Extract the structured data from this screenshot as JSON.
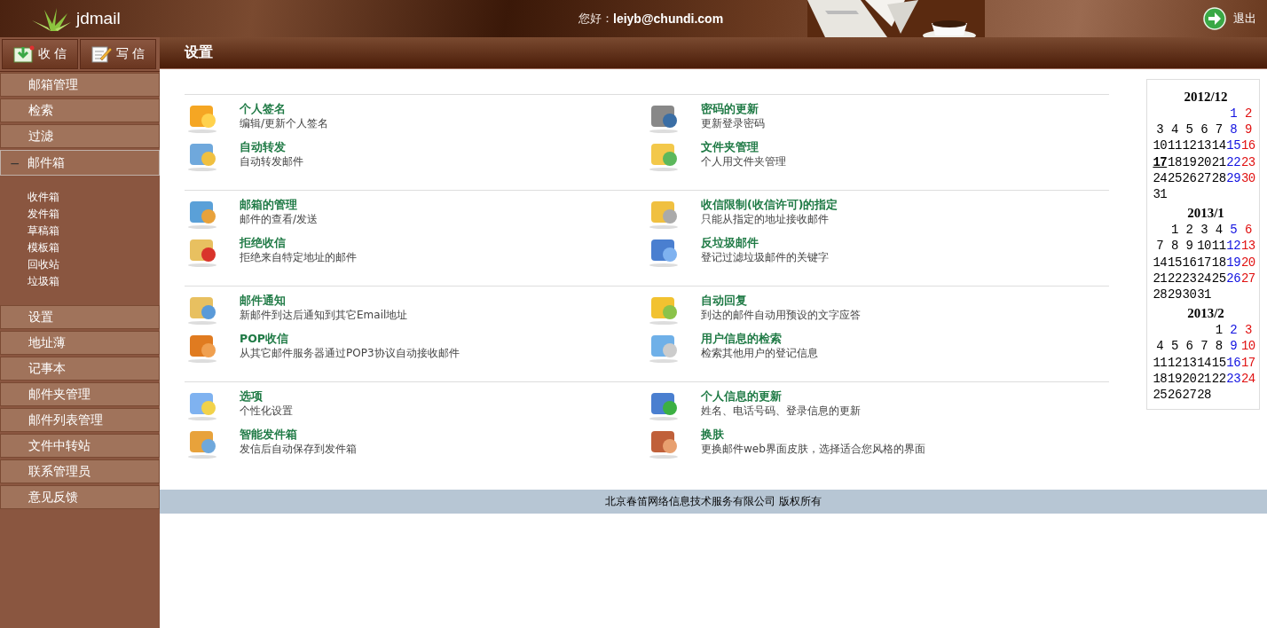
{
  "header": {
    "logo": "jdmail",
    "greeting": "您好：",
    "user": "leiyb@chundi.com",
    "logout": "退出"
  },
  "toolbar": [
    {
      "label": "收 信",
      "kind": "inbox"
    },
    {
      "label": "写 信",
      "kind": "compose"
    }
  ],
  "sidebar": {
    "items": [
      {
        "label": "邮箱管理",
        "kind": "link"
      },
      {
        "label": "检索",
        "kind": "link"
      },
      {
        "label": "过滤",
        "kind": "link"
      },
      {
        "label": "邮件箱",
        "kind": "folder",
        "toggle": "−",
        "expanded": true,
        "children": [
          "收件箱",
          "发件箱",
          "草稿箱",
          "模板箱",
          "回收站",
          "垃圾箱"
        ]
      },
      {
        "label": "设置",
        "kind": "link"
      },
      {
        "label": "地址薄",
        "kind": "link"
      },
      {
        "label": "记事本",
        "kind": "link"
      },
      {
        "label": "邮件夹管理",
        "kind": "link"
      },
      {
        "label": "邮件列表管理",
        "kind": "link"
      },
      {
        "label": "文件中转站",
        "kind": "link"
      },
      {
        "label": "联系管理员",
        "kind": "link"
      },
      {
        "label": "意见反馈",
        "kind": "link"
      }
    ]
  },
  "page_title": "设置",
  "sections": [
    {
      "columns": [
        [
          {
            "title": "个人签名",
            "desc": "编辑/更新个人签名"
          },
          {
            "title": "自动转发",
            "desc": "自动转发邮件"
          }
        ],
        [
          {
            "title": "密码的更新",
            "desc": "更新登录密码"
          },
          {
            "title": "文件夹管理",
            "desc": "个人用文件夹管理"
          }
        ]
      ]
    },
    {
      "columns": [
        [
          {
            "title": "邮箱的管理",
            "desc": "邮件的查看/发送"
          },
          {
            "title": "拒绝收信",
            "desc": "拒绝来自特定地址的邮件"
          }
        ],
        [
          {
            "title": "收信限制(收信许可)的指定",
            "desc": "只能从指定的地址接收邮件"
          },
          {
            "title": "反垃圾邮件",
            "desc": "登记过滤垃圾邮件的关键字"
          }
        ]
      ]
    },
    {
      "columns": [
        [
          {
            "title": "邮件通知",
            "desc": "新邮件到达后通知到其它Email地址"
          },
          {
            "title": "POP收信",
            "desc": "从其它邮件服务器通过POP3协议自动接收邮件"
          }
        ],
        [
          {
            "title": "自动回复",
            "desc": "到达的邮件自动用预设的文字应答"
          },
          {
            "title": "用户信息的检索",
            "desc": "检索其他用户的登记信息"
          }
        ]
      ]
    },
    {
      "columns": [
        [
          {
            "title": "选项",
            "desc": "个性化设置"
          },
          {
            "title": "智能发件箱",
            "desc": "发信后自动保存到发件箱"
          }
        ],
        [
          {
            "title": "个人信息的更新",
            "desc": "姓名、电话号码、登录信息的更新"
          },
          {
            "title": "换肤",
            "desc": "更换邮件web界面皮肤，选择适合您风格的界面"
          }
        ]
      ]
    }
  ],
  "calendar": [
    {
      "title": "2012/12",
      "weeks": [
        [
          {
            "n": "1",
            "today": false
          },
          {
            "n": "2",
            "today": false
          }
        ],
        [
          {
            "n": "3",
            "today": false
          },
          {
            "n": "4",
            "today": false
          },
          {
            "n": "5",
            "today": false
          },
          {
            "n": "6",
            "today": false
          },
          {
            "n": "7",
            "today": false
          },
          {
            "n": "8",
            "today": false
          },
          {
            "n": "9",
            "today": false
          }
        ],
        [
          {
            "n": "10",
            "today": false
          },
          {
            "n": "11",
            "today": false
          },
          {
            "n": "12",
            "today": false
          },
          {
            "n": "13",
            "today": false
          },
          {
            "n": "14",
            "today": false
          },
          {
            "n": "15",
            "today": false
          },
          {
            "n": "16",
            "today": false
          }
        ],
        [
          {
            "n": "17",
            "today": true
          },
          {
            "n": "18",
            "today": false
          },
          {
            "n": "19",
            "today": false
          },
          {
            "n": "20",
            "today": false
          },
          {
            "n": "21",
            "today": false
          },
          {
            "n": "22",
            "today": false
          },
          {
            "n": "23",
            "today": false
          }
        ],
        [
          {
            "n": "24",
            "today": false
          },
          {
            "n": "25",
            "today": false
          },
          {
            "n": "26",
            "today": false
          },
          {
            "n": "27",
            "today": false
          },
          {
            "n": "28",
            "today": false
          },
          {
            "n": "29",
            "today": false
          },
          {
            "n": "30",
            "today": false
          }
        ],
        [
          {
            "n": "31",
            "today": false
          }
        ]
      ]
    },
    {
      "title": "2013/1",
      "weeks": [
        [
          {
            "n": "1",
            "today": false
          },
          {
            "n": "2",
            "today": false
          },
          {
            "n": "3",
            "today": false
          },
          {
            "n": "4",
            "today": false
          },
          {
            "n": "5",
            "today": false
          },
          {
            "n": "6",
            "today": false
          }
        ],
        [
          {
            "n": "7",
            "today": false
          },
          {
            "n": "8",
            "today": false
          },
          {
            "n": "9",
            "today": false
          },
          {
            "n": "10",
            "today": false
          },
          {
            "n": "11",
            "today": false
          },
          {
            "n": "12",
            "today": false
          },
          {
            "n": "13",
            "today": false
          }
        ],
        [
          {
            "n": "14",
            "today": false
          },
          {
            "n": "15",
            "today": false
          },
          {
            "n": "16",
            "today": false
          },
          {
            "n": "17",
            "today": false
          },
          {
            "n": "18",
            "today": false
          },
          {
            "n": "19",
            "today": false
          },
          {
            "n": "20",
            "today": false
          }
        ],
        [
          {
            "n": "21",
            "today": false
          },
          {
            "n": "22",
            "today": false
          },
          {
            "n": "23",
            "today": false
          },
          {
            "n": "24",
            "today": false
          },
          {
            "n": "25",
            "today": false
          },
          {
            "n": "26",
            "today": false
          },
          {
            "n": "27",
            "today": false
          }
        ],
        [
          {
            "n": "28",
            "today": false
          },
          {
            "n": "29",
            "today": false
          },
          {
            "n": "30",
            "today": false
          },
          {
            "n": "31",
            "today": false
          }
        ]
      ]
    },
    {
      "title": "2013/2",
      "weeks": [
        [
          {
            "n": "1",
            "today": false
          },
          {
            "n": "2",
            "today": false
          },
          {
            "n": "3",
            "today": false
          }
        ],
        [
          {
            "n": "4",
            "today": false
          },
          {
            "n": "5",
            "today": false
          },
          {
            "n": "6",
            "today": false
          },
          {
            "n": "7",
            "today": false
          },
          {
            "n": "8",
            "today": false
          },
          {
            "n": "9",
            "today": false
          },
          {
            "n": "10",
            "today": false
          }
        ],
        [
          {
            "n": "11",
            "today": false
          },
          {
            "n": "12",
            "today": false
          },
          {
            "n": "13",
            "today": false
          },
          {
            "n": "14",
            "today": false
          },
          {
            "n": "15",
            "today": false
          },
          {
            "n": "16",
            "today": false
          },
          {
            "n": "17",
            "today": false
          }
        ],
        [
          {
            "n": "18",
            "today": false
          },
          {
            "n": "19",
            "today": false
          },
          {
            "n": "20",
            "today": false
          },
          {
            "n": "21",
            "today": false
          },
          {
            "n": "22",
            "today": false
          },
          {
            "n": "23",
            "today": false
          },
          {
            "n": "24",
            "today": false
          }
        ],
        [
          {
            "n": "25",
            "today": false
          },
          {
            "n": "26",
            "today": false
          },
          {
            "n": "27",
            "today": false
          },
          {
            "n": "28",
            "today": false
          }
        ]
      ]
    }
  ],
  "footer": "北京春笛网络信息技术服务有限公司 版权所有"
}
